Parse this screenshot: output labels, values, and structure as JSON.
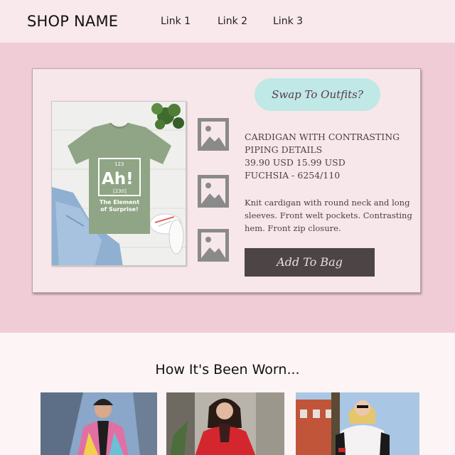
{
  "header": {
    "shop_name": "SHOP NAME",
    "links": [
      "Link 1",
      "Link 2",
      "Link 3"
    ]
  },
  "product": {
    "swap_label": "Swap To Outfits?",
    "title_line1": "CARDIGAN WITH CONTRASTING",
    "title_line2": "PIPING DETAILS",
    "price": "39.90 USD 15.99 USD",
    "color_ref": "FUCHSIA - 6254/110",
    "description": "Knit cardigan with round neck and long sleeves. Front welt pockets. Contrasting hem. Front zip closure.",
    "add_to_bag_label": "Add To Bag",
    "shirt_print": {
      "number": "123",
      "symbol": "Ah!",
      "mass": "[230]",
      "caption_line1": "The Element",
      "caption_line2": "of Surprise!"
    },
    "thumbnails": [
      "image-placeholder-icon",
      "image-placeholder-icon",
      "image-placeholder-icon"
    ]
  },
  "worn": {
    "title": "How It's Been Worn..."
  },
  "colors": {
    "header_bg": "#f9e8ec",
    "hero_bg": "#f0cdd6",
    "card_bg": "#f8e7ea",
    "swap_bg": "#bfe8e6",
    "bag_bg": "#4c4445",
    "shirt": "#8fa585"
  }
}
